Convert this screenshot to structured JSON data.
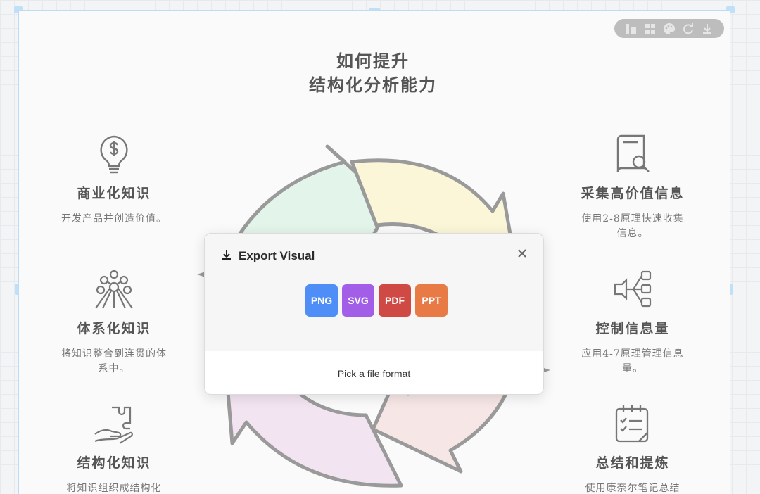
{
  "title": {
    "line1": "如何提升",
    "line2": "结构化分析能力"
  },
  "left_items": [
    {
      "title": "商业化知识",
      "desc": "开发产品并创造价值。",
      "icon": "lightbulb-dollar-icon"
    },
    {
      "title": "体系化知识",
      "desc": "将知识整合到连贯的体系中。",
      "icon": "network-molecule-icon"
    },
    {
      "title": "结构化知识",
      "desc": "将知识组织成结构化",
      "icon": "hand-puzzle-icon"
    }
  ],
  "right_items": [
    {
      "title": "采集高价值信息",
      "desc": "使用2-8原理快速收集信息。",
      "icon": "book-search-icon"
    },
    {
      "title": "控制信息量",
      "desc": "应用4-7原理管理信息量。",
      "icon": "flow-boxes-icon"
    },
    {
      "title": "总结和提炼",
      "desc": "使用康奈尔笔记总结",
      "icon": "checklist-notebook-icon"
    }
  ],
  "modal": {
    "title": "Export Visual",
    "formats": [
      {
        "label": "PNG",
        "color": "#4f8ef7"
      },
      {
        "label": "SVG",
        "color": "#a35ee8"
      },
      {
        "label": "PDF",
        "color": "#cf4a44"
      },
      {
        "label": "PPT",
        "color": "#e87a45"
      }
    ],
    "footer": "Pick a file format"
  },
  "colors": {
    "segment_green": "#e3f5ea",
    "segment_yellow": "#fbf6d8",
    "segment_pink": "#f3e4f1",
    "segment_rose": "#f6e6e6",
    "outline": "#9a9a9a"
  }
}
